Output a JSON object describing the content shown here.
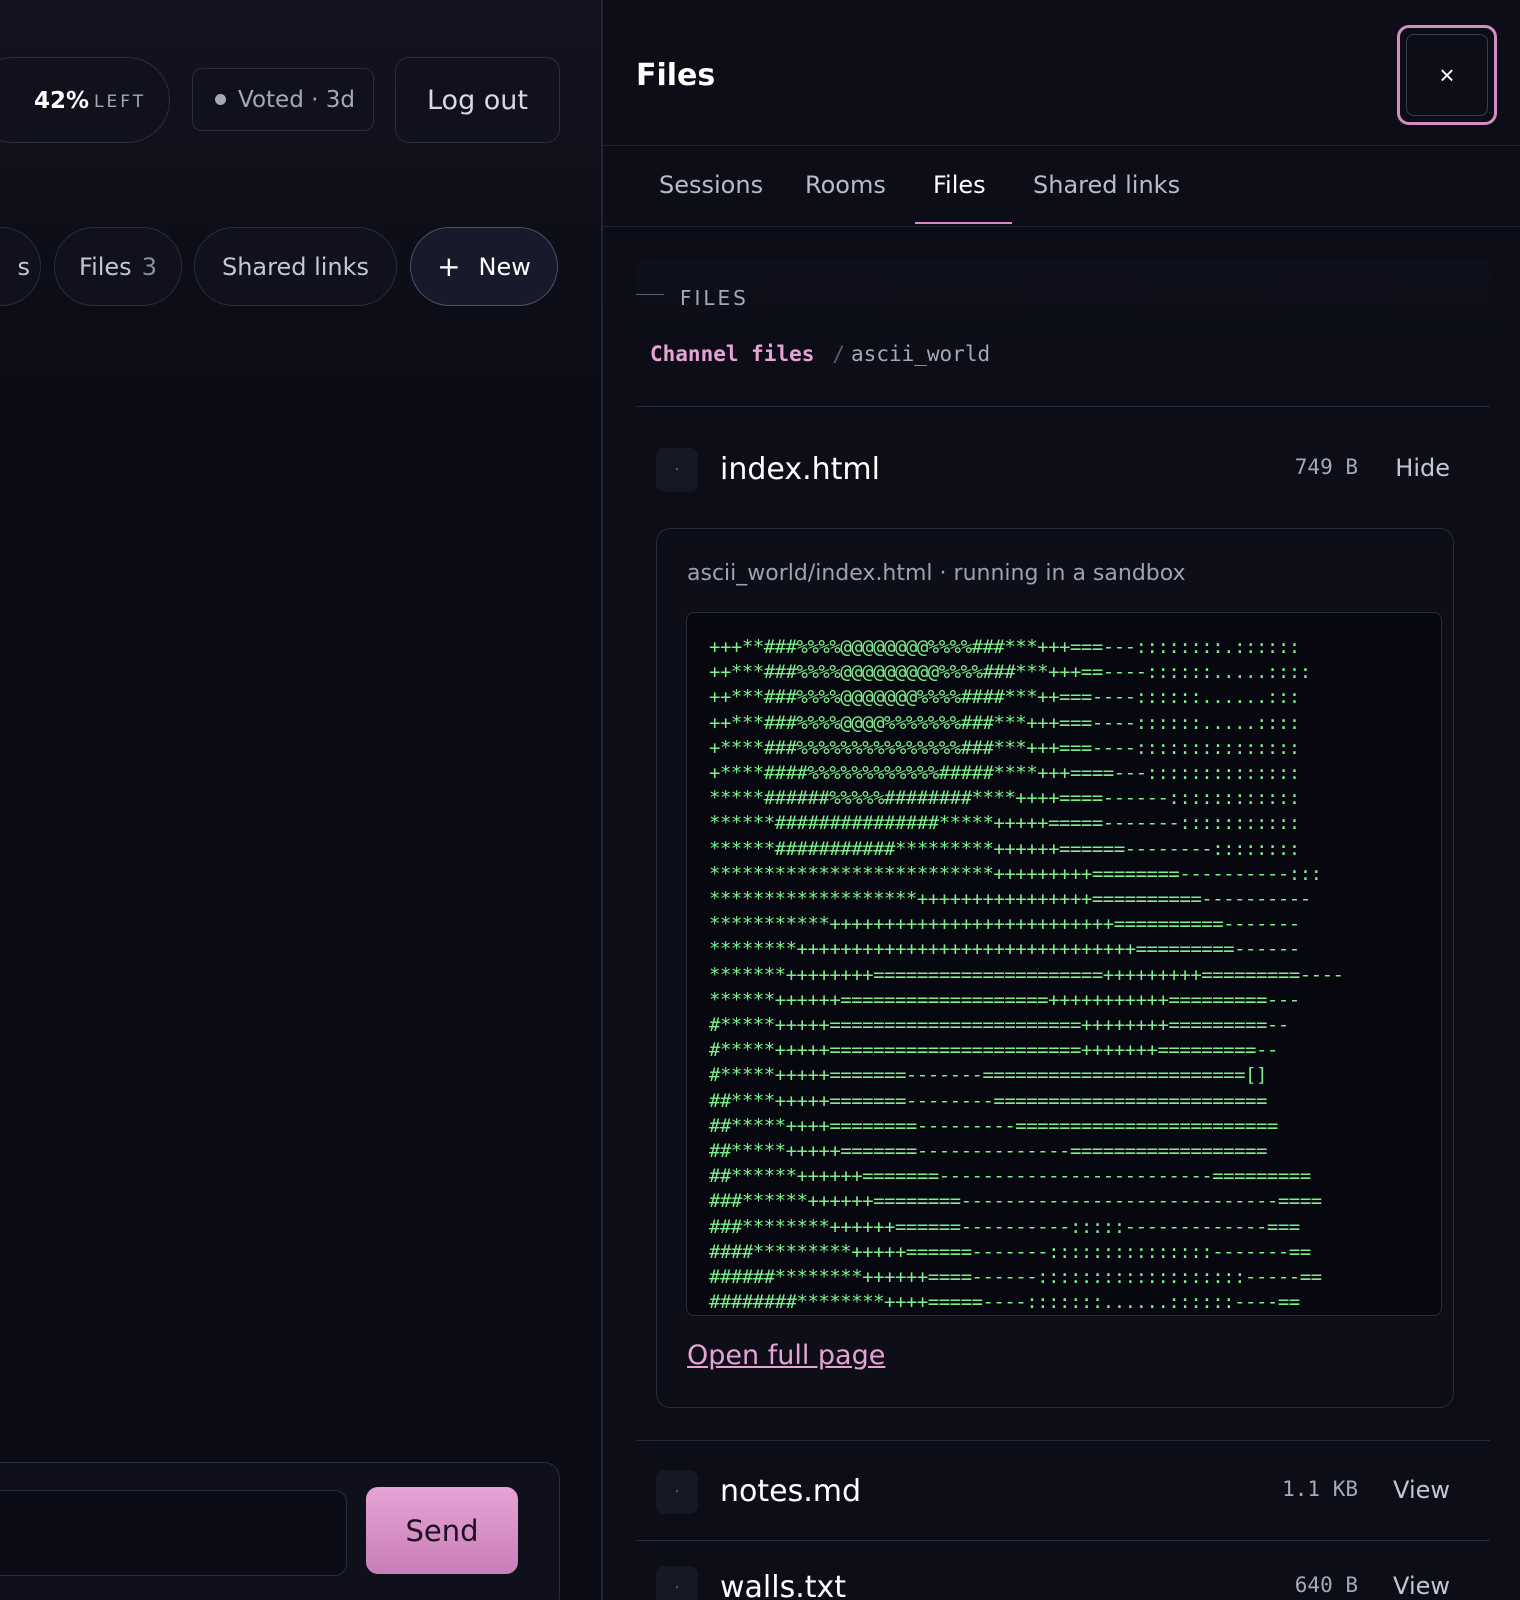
{
  "header": {
    "usage_percent": "42%",
    "usage_label": "LEFT",
    "vote_status": "Voted · 3d",
    "logout_label": "Log out"
  },
  "chips": {
    "fragment": "s",
    "files_label": "Files",
    "files_count": "3",
    "shared_links": "Shared links",
    "new_label": "New"
  },
  "composer": {
    "message_value": "",
    "send_label": "Send"
  },
  "drawer": {
    "title": "Files",
    "close_glyph": "×",
    "tabs": [
      {
        "label": "Sessions"
      },
      {
        "label": "Rooms"
      },
      {
        "label": "Files"
      },
      {
        "label": "Shared links"
      }
    ],
    "active_tab": "Files",
    "section_label": "FILES",
    "breadcrumb": {
      "root": "Channel files",
      "separator": "/",
      "leaf": "ascii_world"
    },
    "files": [
      {
        "name": "index.html",
        "size": "749 B",
        "action": "Hide"
      },
      {
        "name": "notes.md",
        "size": "1.1 KB",
        "action": "View"
      },
      {
        "name": "walls.txt",
        "size": "640 B",
        "action": "View"
      }
    ],
    "preview": {
      "caption": "ascii_world/index.html · running in a sandbox",
      "ascii": "+++**###%%%%@@@@@@@@%%%%###***+++===---::::::::.::::::\n++***###%%%%@@@@@@@@@%%%%###***+++==----::::::.....::::\n++***###%%%%@@@@@@@%%%%####***++===----::::::......:::\n++***###%%%%@@@@%%%%%%%###***+++===----::::::.....::::\n+****###%%%%%%%%%%%%%%%###***+++===----:::::::::::::::\n+****####%%%%%%%%%%%%#####****+++====---::::::::::::::\n*****######%%%%%########****++++====------::::::::::::\n******###############*****+++++=====-------:::::::::::\n******###########*********++++++======--------::::::::\n**************************+++++++++========----------:::\n*******************++++++++++++++++==========----------\n***********++++++++++++++++++++++++++==========-------\n********+++++++++++++++++++++++++++++++=========------\n*******++++++++=====================+++++++++=========----\n******++++++===================+++++++++++=========---\n#*****+++++=======================++++++++=========--\n#*****+++++=======================+++++++=========--\n#*****+++++=======-------========================[]\n##****+++++=======--------=========================\n##*****++++========---------========================\n##*****+++++=======--------------==================\n##******++++++=======-------------------------=========\n###******++++++========-----------------------------====\n###********++++++======----------:::::-------------===\n####*********+++++======-------:::::::::::::::-------==\n######********++++++====------:::::::::::::::::::-----==\n########********++++=====----:::::::......::::::----=="
    },
    "open_full_page": "Open full page"
  },
  "colors": {
    "accent_pink": "#e7a3d5",
    "terminal_green": "#7cf08a",
    "usage_ring": "#2fd06a"
  },
  "icons": {
    "usage": "usage-ring-icon",
    "vote": "dot-icon",
    "new": "plus-icon",
    "close": "close-icon",
    "file": "file-icon"
  }
}
